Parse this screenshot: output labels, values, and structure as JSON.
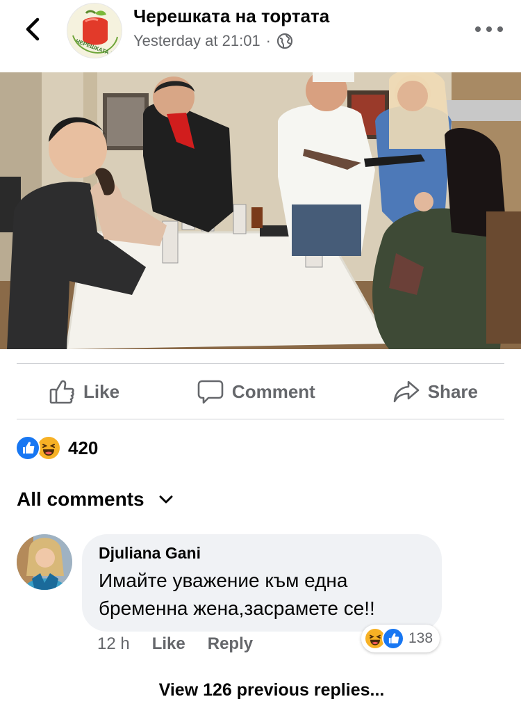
{
  "header": {
    "back_icon": "chevron-left-icon",
    "page_name": "Черешката на тортата",
    "logo_text": "ЧЕРЕШКАТА НА ТОРТАТА",
    "timestamp": "Yesterday at 21:01",
    "separator": "·",
    "privacy_icon": "globe-icon",
    "more_icon": "more-horizontal-icon"
  },
  "actions": {
    "like_label": "Like",
    "comment_label": "Comment",
    "share_label": "Share"
  },
  "reactions": {
    "types": [
      "like",
      "haha"
    ],
    "count": "420"
  },
  "comments_filter": {
    "label": "All comments",
    "icon": "chevron-down-icon"
  },
  "comment": {
    "author": "Djuliana Gani",
    "text_line1": "Имайте уважение към една",
    "text_line2": "бременна жена,засрамете се!!",
    "age": "12 h",
    "like_label": "Like",
    "reply_label": "Reply",
    "reactions": [
      "haha",
      "like"
    ],
    "reaction_count": "138"
  },
  "view_replies": "View 126 previous replies...",
  "colors": {
    "accent": "#1877f2",
    "haha": "#f7b125",
    "secondary_text": "#65676b",
    "bubble": "#f0f2f5",
    "divider": "#ced0d4"
  }
}
